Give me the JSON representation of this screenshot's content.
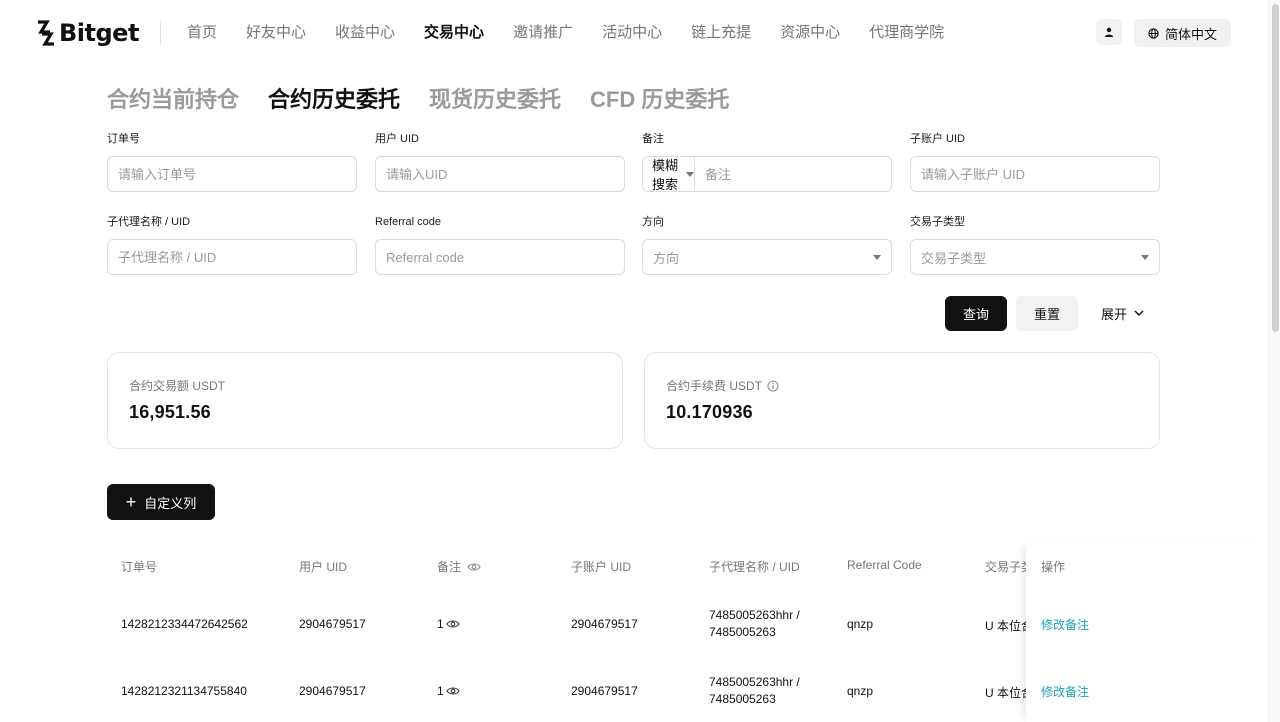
{
  "header": {
    "logo_text": "Bitget",
    "nav": [
      "首页",
      "好友中心",
      "收益中心",
      "交易中心",
      "邀请推广",
      "活动中心",
      "链上充提",
      "资源中心",
      "代理商学院"
    ],
    "nav_active_index": 3,
    "lang_label": "简体中文"
  },
  "tabs": {
    "items": [
      "合约当前持仓",
      "合约历史委托",
      "现货历史委托",
      "CFD 历史委托"
    ],
    "active_index": 1
  },
  "filters": {
    "order_no": {
      "label": "订单号",
      "placeholder": "请输入订单号"
    },
    "user_uid": {
      "label": "用户 UID",
      "placeholder": "请输入UID"
    },
    "remark": {
      "label": "备注",
      "mode": "模糊搜索",
      "placeholder": "备注"
    },
    "sub_uid": {
      "label": "子账户 UID",
      "placeholder": "请输入子账户 UID"
    },
    "sub_agent": {
      "label": "子代理名称 / UID",
      "placeholder": "子代理名称 / UID"
    },
    "referral": {
      "label": "Referral code",
      "placeholder": "Referral code"
    },
    "direction": {
      "label": "方向",
      "placeholder": "方向"
    },
    "trade_subtype": {
      "label": "交易子类型",
      "placeholder": "交易子类型"
    }
  },
  "actions": {
    "query": "查询",
    "reset": "重置",
    "expand": "展开"
  },
  "stats": {
    "volume": {
      "label": "合约交易额 USDT",
      "value": "16,951.56"
    },
    "fee": {
      "label": "合约手续费 USDT",
      "value": "10.170936"
    }
  },
  "custom_columns_label": "自定义列",
  "table": {
    "headers": {
      "order_no": "订单号",
      "user_uid": "用户 UID",
      "remark": "备注",
      "sub_uid": "子账户 UID",
      "sub_agent": "子代理名称 / UID",
      "referral": "Referral Code",
      "trade_subtype": "交易子类",
      "op": "操作"
    },
    "rows": [
      {
        "order_no": "1428212334472642562",
        "user_uid": "2904679517",
        "remark": "1",
        "sub_uid": "2904679517",
        "sub_agent_name": "7485005263hhr /",
        "sub_agent_uid": "7485005263",
        "referral": "qnzp",
        "trade_subtype": "U 本位合",
        "op": "修改备注"
      },
      {
        "order_no": "1428212321134755840",
        "user_uid": "2904679517",
        "remark": "1",
        "sub_uid": "2904679517",
        "sub_agent_name": "7485005263hhr /",
        "sub_agent_uid": "7485005263",
        "referral": "qnzp",
        "trade_subtype": "U 本位合",
        "op": "修改备注"
      }
    ]
  }
}
